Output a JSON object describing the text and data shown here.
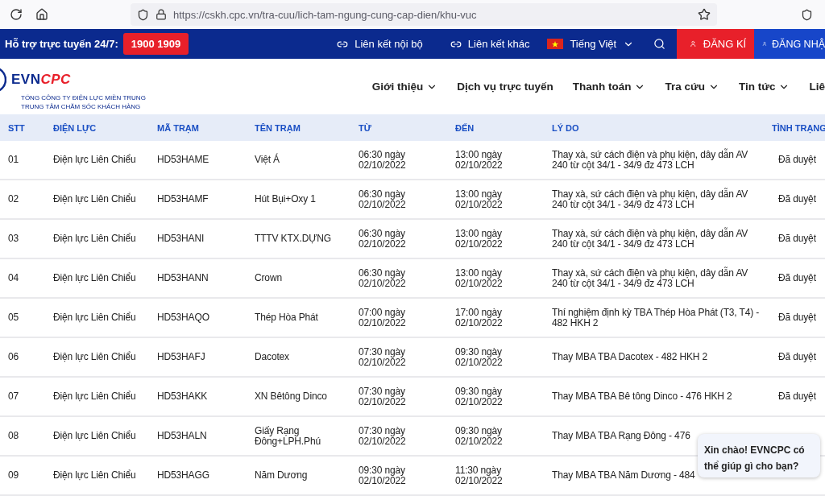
{
  "browser": {
    "url": "https://cskh.cpc.vn/tra-cuu/lich-tam-ngung-cung-cap-dien/khu-vuc"
  },
  "top_bar": {
    "support_label": "Hỗ trợ trực tuyến 24/7:",
    "hotline": "1900 1909",
    "links": [
      "Liên kết nội bộ",
      "Liên kết khác"
    ],
    "language": "Tiếng Việt",
    "register": "ĐĂNG KÍ",
    "login": "ĐĂNG NHẬ"
  },
  "header": {
    "logo": {
      "evn": "EVN",
      "cpc": "CPC",
      "line_1": "TỔNG CÔNG TY ĐIỆN LỰC MIỀN TRUNG",
      "line_2": "TRUNG TÂM CHĂM SÓC KHÁCH HÀNG"
    },
    "nav": [
      {
        "label": "Giới thiệu",
        "dropdown": true
      },
      {
        "label": "Dịch vụ trực tuyến",
        "dropdown": false
      },
      {
        "label": "Thanh toán",
        "dropdown": true
      },
      {
        "label": "Tra cứu",
        "dropdown": true
      },
      {
        "label": "Tin tức",
        "dropdown": true
      },
      {
        "label": "Liê",
        "dropdown": false
      }
    ]
  },
  "table": {
    "columns": [
      "STT",
      "ĐIỆN LỰC",
      "MÃ TRẠM",
      "TÊN TRẠM",
      "TỪ",
      "ĐẾN",
      "LÝ DO",
      "TÌNH TRẠNG"
    ],
    "rows": [
      [
        "01",
        "Điện lực Liên Chiểu",
        "HD53HAME",
        "Việt Á",
        "06:30 ngày 02/10/2022",
        "13:00 ngày 02/10/2022",
        "Thay xà, sứ cách điện và phụ kiện, dây dẫn AV 240 từ cột 34/1 - 34/9 đz 473 LCH",
        "Đã duyệt"
      ],
      [
        "02",
        "Điện lực Liên Chiểu",
        "HD53HAMF",
        "Hút Bụi+Oxy 1",
        "06:30 ngày 02/10/2022",
        "13:00 ngày 02/10/2022",
        "Thay xà, sứ cách điện và phụ kiện, dây dẫn AV 240 từ cột 34/1 - 34/9 đz 473 LCH",
        "Đã duyệt"
      ],
      [
        "03",
        "Điện lực Liên Chiểu",
        "HD53HANI",
        "TTTV KTX.DỰNG",
        "06:30 ngày 02/10/2022",
        "13:00 ngày 02/10/2022",
        "Thay xà, sứ cách điện và phụ kiện, dây dẫn AV 240 từ cột 34/1 - 34/9 đz 473 LCH",
        "Đã duyệt"
      ],
      [
        "04",
        "Điện lực Liên Chiểu",
        "HD53HANN",
        "Crown",
        "06:30 ngày 02/10/2022",
        "13:00 ngày 02/10/2022",
        "Thay xà, sứ cách điện và phụ kiện, dây dẫn AV 240 từ cột 34/1 - 34/9 đz 473 LCH",
        "Đã duyệt"
      ],
      [
        "05",
        "Điện lực Liên Chiểu",
        "HD53HAQO",
        "Thép Hòa Phát",
        "07:00 ngày 02/10/2022",
        "17:00 ngày 02/10/2022",
        "Thí nghiệm định kỳ TBA Thép Hòa Phát (T3, T4) - 482 HKH 2",
        "Đã duyệt"
      ],
      [
        "06",
        "Điện lực Liên Chiểu",
        "HD53HAFJ",
        "Dacotex",
        "07:30 ngày 02/10/2022",
        "09:30 ngày 02/10/2022",
        "Thay MBA TBA Dacotex - 482 HKH 2",
        "Đã duyệt"
      ],
      [
        "07",
        "Điện lực Liên Chiểu",
        "HD53HAKK",
        "XN Bêtông Dinco",
        "07:30 ngày 02/10/2022",
        "09:30 ngày 02/10/2022",
        "Thay MBA TBA Bê tông Dinco - 476 HKH 2",
        "Đã duyệt"
      ],
      [
        "08",
        "Điện lực Liên Chiểu",
        "HD53HALN",
        "Giấy Rạng Đông+LPH.Phú",
        "07:30 ngày 02/10/2022",
        "09:30 ngày 02/10/2022",
        "Thay MBA TBA Rạng Đông - 476"
      ],
      [
        "09",
        "Điện lực Liên Chiểu",
        "HD53HAGG",
        "Năm Dương",
        "09:30 ngày 02/10/2022",
        "11:30 ngày 02/10/2022",
        "Thay MBA TBA Năm Dương - 484"
      ]
    ]
  },
  "chat_bubble": {
    "text": "Xin chào! EVNCPC có thể giúp gì cho bạn?"
  }
}
